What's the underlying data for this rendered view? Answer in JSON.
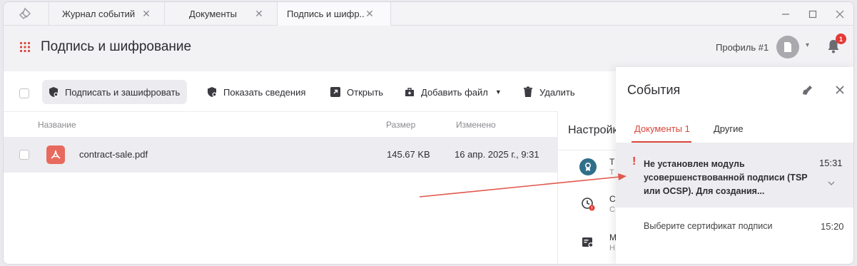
{
  "tabs": [
    {
      "label": "Журнал событий"
    },
    {
      "label": "Документы"
    },
    {
      "label": "Подпись и шифр..."
    }
  ],
  "header": {
    "title": "Подпись и шифрование",
    "profile": "Профиль #1",
    "notifications_count": "1"
  },
  "toolbar": {
    "sign_encrypt": "Подписать и зашифровать",
    "show_info": "Показать сведения",
    "open": "Открыть",
    "add_file": "Добавить файл",
    "delete": "Удалить"
  },
  "table": {
    "columns": {
      "name": "Название",
      "size": "Размер",
      "modified": "Изменено"
    },
    "rows": [
      {
        "name": "contract-sale.pdf",
        "size": "145.67 KB",
        "modified": "16 апр. 2025 г., 9:31"
      }
    ]
  },
  "settings": {
    "title": "Настройк",
    "items": [
      {
        "title": "Т",
        "sub": "Т",
        "icon": "badge-icon",
        "color": "#2f6f8a"
      },
      {
        "title": "С",
        "sub": "С",
        "icon": "clock-icon"
      },
      {
        "title": "М",
        "sub": "Н",
        "icon": "cert-icon"
      }
    ]
  },
  "events": {
    "title": "События",
    "tabs": {
      "documents": "Документы 1",
      "other": "Другие"
    },
    "items": [
      {
        "message": "Не установлен модуль усовершенствованной подписи (TSP или OCSP). Для создания...",
        "time": "15:31",
        "level": "warning"
      },
      {
        "message": "Выберите сертификат подписи",
        "time": "15:20",
        "level": "info"
      }
    ]
  },
  "colors": {
    "accent": "#d9473a",
    "pdf_icon": "#e86a5e",
    "badge": "#e53935"
  }
}
